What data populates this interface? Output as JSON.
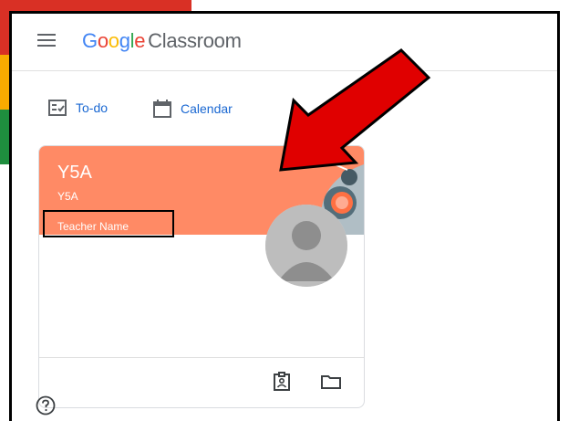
{
  "app": {
    "logo_google": "Google",
    "logo_product": "Classroom"
  },
  "nav": {
    "todo_label": "To-do",
    "calendar_label": "Calendar"
  },
  "class_card": {
    "title": "Y5A",
    "section": "Y5A",
    "teacher": "Teacher Name",
    "banner_color": "#ff8a65"
  },
  "icons": {
    "menu": "hamburger-menu-icon",
    "todo": "todo-list-icon",
    "calendar": "calendar-icon",
    "assignments": "assignment-icon",
    "folder": "folder-icon",
    "help": "help-icon"
  },
  "annotation": {
    "arrow_color": "#e00000"
  }
}
